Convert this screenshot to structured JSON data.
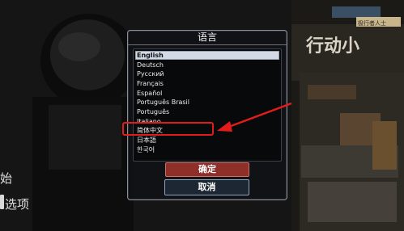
{
  "background": {
    "banner_text": "行动小",
    "banner_tag": "极行者人士"
  },
  "side_menu": {
    "start_label": "始",
    "options_label": "选项"
  },
  "dialog": {
    "title": "语言",
    "languages": [
      "English",
      "Deutsch",
      "Русский",
      "Français",
      "Español",
      "Português Brasil",
      "Português",
      "Italiano",
      "简体中文",
      "日本語",
      "한국어"
    ],
    "selected_language": "English",
    "confirm_label": "确定",
    "cancel_label": "取消"
  },
  "annotation": {
    "highlighted_language": "简体中文",
    "color": "#e21b1b"
  }
}
